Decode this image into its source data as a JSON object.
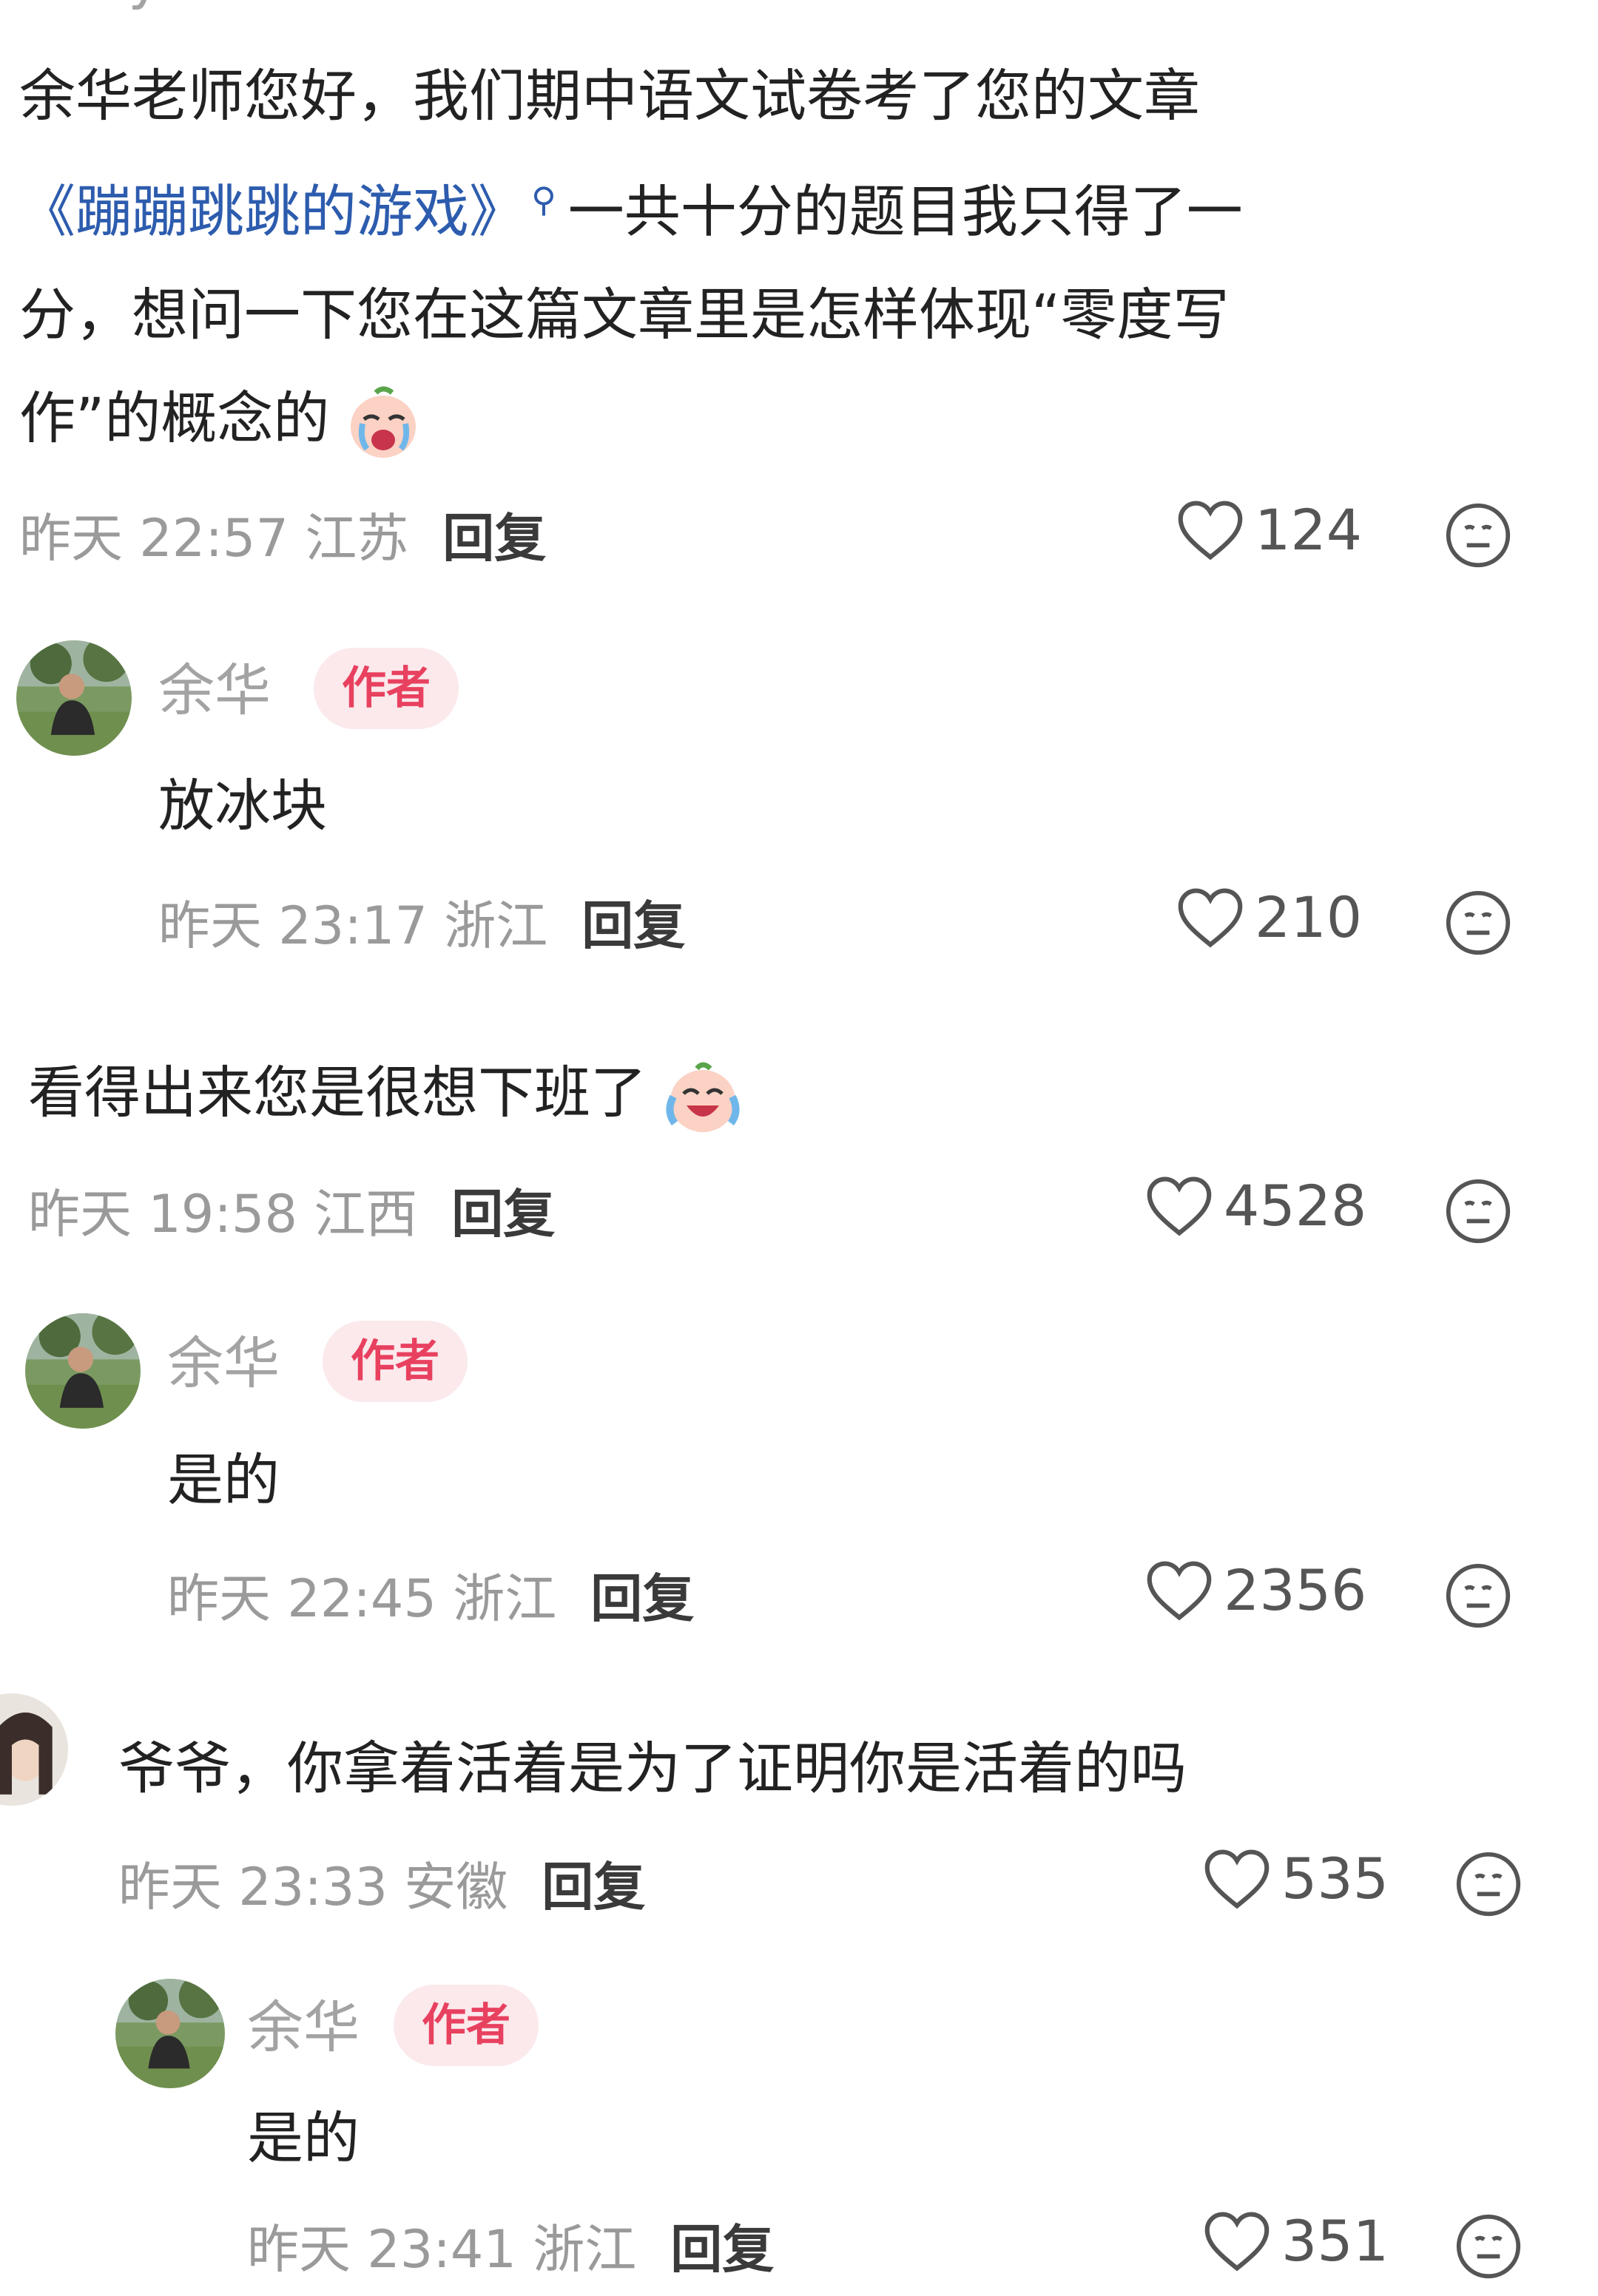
{
  "comments": [
    {
      "user": "rainy",
      "text_1": "余华老师您好，我们期中语文试卷考了您的文章",
      "text_link": "《蹦蹦跳跳的游戏》",
      "text_2": "一共十分的题目我只得了一",
      "text_3": "分，想问一下您在这篇文章里是怎样体现“零度写",
      "text_4": "作”的概念的",
      "emoji": "crying-face-emoji",
      "time": "昨天 22:57 江苏",
      "reply": "回复",
      "likes": "124"
    },
    {
      "user": "余华",
      "badge": "作者",
      "text": "放冰块",
      "time": "昨天 23:17 浙江",
      "reply": "回复",
      "likes": "210"
    },
    {
      "text": "看得出来您是很想下班了",
      "emoji": "laugh-cry-emoji",
      "time": "昨天 19:58 江西",
      "reply": "回复",
      "likes": "4528"
    },
    {
      "user": "余华",
      "badge": "作者",
      "text": "是的",
      "time": "昨天 22:45 浙江",
      "reply": "回复",
      "likes": "2356"
    },
    {
      "text": "爷爷，你拿着活着是为了证明你是活着的吗",
      "time": "昨天 23:33 安徽",
      "reply": "回复",
      "likes": "535"
    },
    {
      "user": "余华",
      "badge": "作者",
      "text": "是的",
      "time": "昨天 23:41 浙江",
      "reply": "回复",
      "likes": "351"
    }
  ],
  "icons": {
    "like": "heart-outline-icon",
    "dislike": "meh-face-icon",
    "search_hint": "search-icon"
  },
  "colors": {
    "link": "#2d5cae",
    "badge_text": "#e8415f",
    "badge_bg": "#fbe9ec",
    "meta": "#9a9a9a"
  }
}
